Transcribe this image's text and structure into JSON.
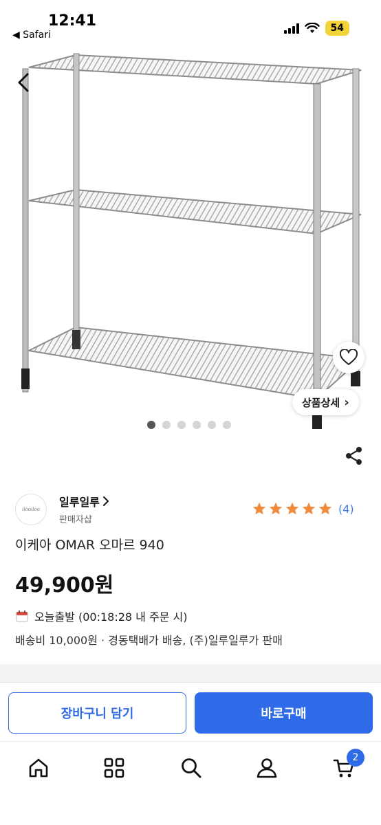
{
  "status_bar": {
    "time": "12:41",
    "back_app": "◀ Safari",
    "battery": "54"
  },
  "product_image": {
    "detail_label": "상품상세",
    "detail_chevron": "›",
    "pagination": {
      "total": 6,
      "active": 1
    }
  },
  "seller": {
    "logo_text": "ilooiloo",
    "name": "일루일루",
    "sub": "판매자샵"
  },
  "rating": {
    "stars": 5,
    "count": "(4)",
    "star_color": "#f08a3c"
  },
  "product": {
    "title": "이케아 OMAR 오마르 940",
    "price": "49,900원"
  },
  "shipping": {
    "today": "오늘출발 (00:18:28 내 주문 시)",
    "info": "배송비 10,000원 · 경동택배가 배송, (주)일루일루가 판매"
  },
  "actions": {
    "cart_label": "장바구니 담기",
    "buy_label": "바로구매"
  },
  "bottom_nav": {
    "items": [
      "home-icon",
      "category-grid-icon",
      "search-icon",
      "user-icon",
      "cart-icon"
    ],
    "cart_badge": "2"
  },
  "colors": {
    "accent": "#2f6be8"
  }
}
